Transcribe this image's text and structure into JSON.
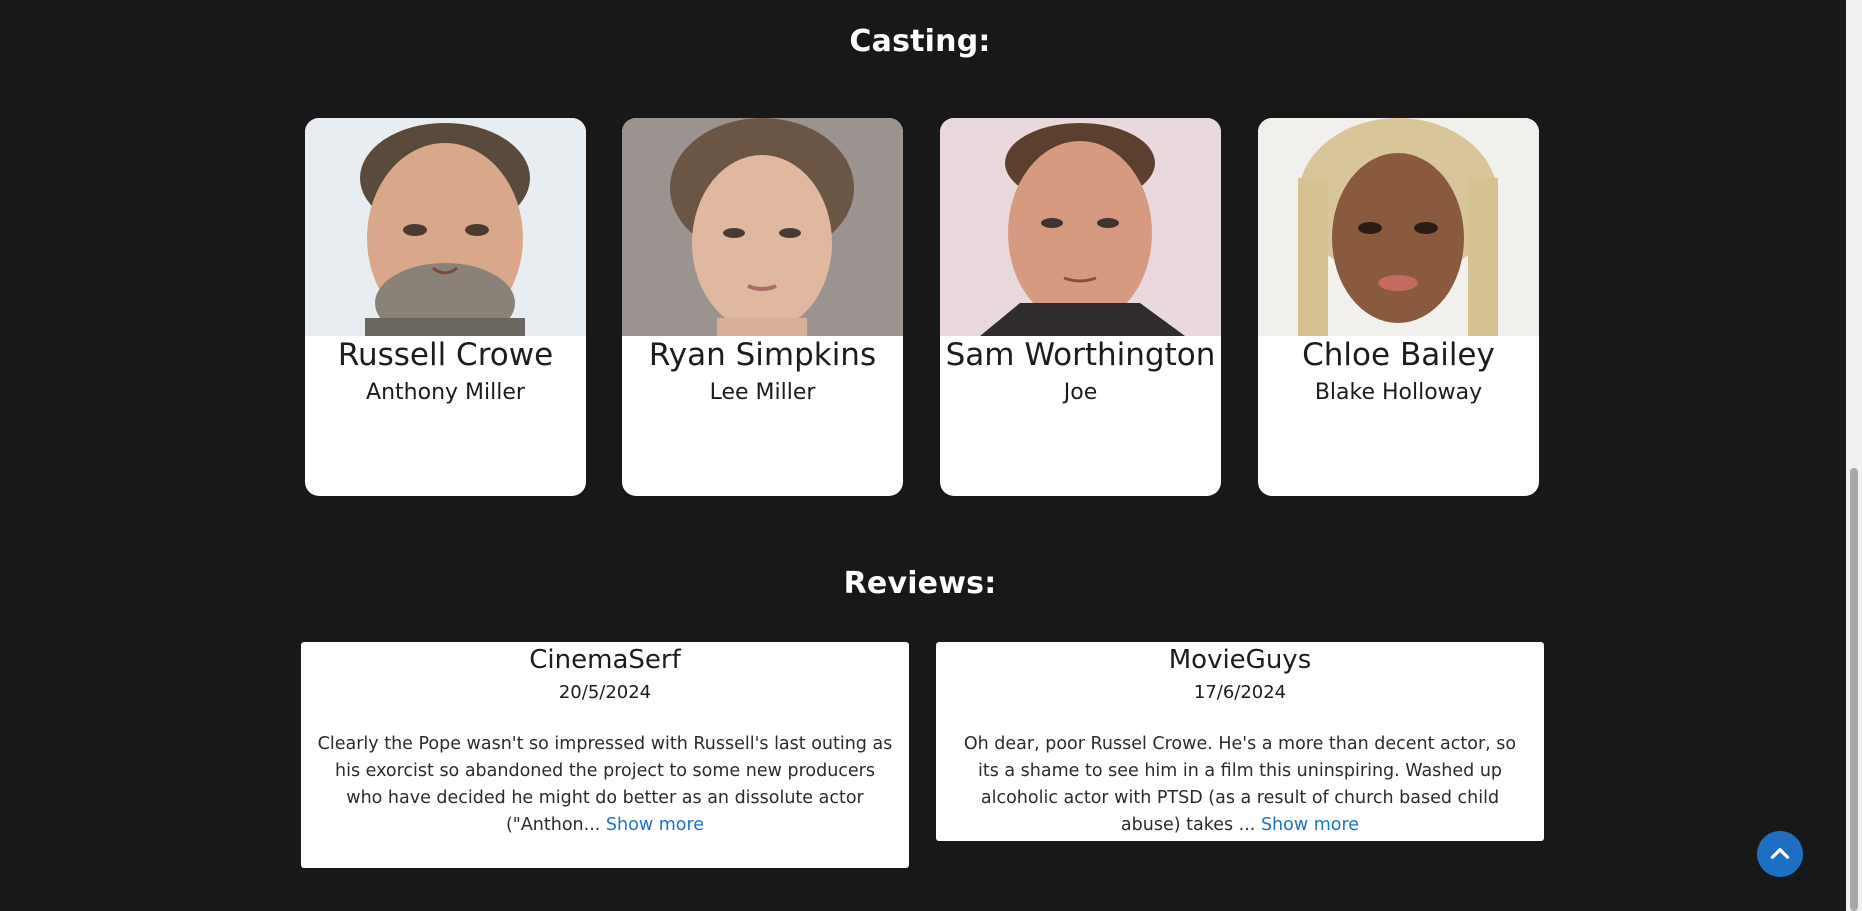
{
  "casting": {
    "title": "Casting:",
    "members": [
      {
        "actor": "Russell Crowe",
        "role": "Anthony Miller"
      },
      {
        "actor": "Ryan Simpkins",
        "role": "Lee Miller"
      },
      {
        "actor": "Sam Worthington",
        "role": "Joe"
      },
      {
        "actor": "Chloe Bailey",
        "role": "Blake Holloway"
      }
    ]
  },
  "reviews": {
    "title": "Reviews:",
    "items": [
      {
        "author": "CinemaSerf",
        "date": "20/5/2024",
        "excerpt": "Clearly the Pope wasn't so impressed with Russell's last outing as his exorcist so abandoned the project to some new producers who have decided he might do better as an dissolute actor (\"Anthon...",
        "more_label": "Show more"
      },
      {
        "author": "MovieGuys",
        "date": "17/6/2024",
        "excerpt": "Oh dear, poor Russel Crowe. He's a more than decent actor, so its a shame to see him in a film this uninspiring. Washed up alcoholic actor with PTSD (as a result of church based child abuse) takes ...",
        "more_label": "Show more"
      }
    ]
  },
  "scroll_top": {
    "icon": "chevron-up-icon"
  },
  "colors": {
    "background": "#181818",
    "card": "#ffffff",
    "link": "#1a73c7",
    "scroll_button": "#1e6fc4"
  }
}
